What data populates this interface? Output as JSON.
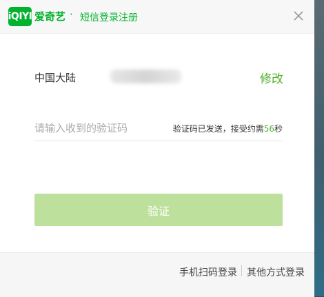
{
  "brand": {
    "logo_text": "iQIYI",
    "name": "爱奇艺",
    "separator": "·"
  },
  "header": {
    "title": "短信登录注册"
  },
  "form": {
    "region_label": "中国大陆",
    "phone_masked": "",
    "edit_label": "修改",
    "code_placeholder": "请输入收到的验证码",
    "sent_hint_prefix": "验证码已发送，接受约需",
    "sent_countdown": "56",
    "sent_hint_suffix": "秒",
    "verify_label": "验证"
  },
  "footer": {
    "qr_login_label": "手机扫码登录",
    "other_login_label": "其他方式登录"
  },
  "colors": {
    "brand_green": "#00b22d",
    "link_green": "#52b12f",
    "button_disabled": "#bde19c"
  }
}
